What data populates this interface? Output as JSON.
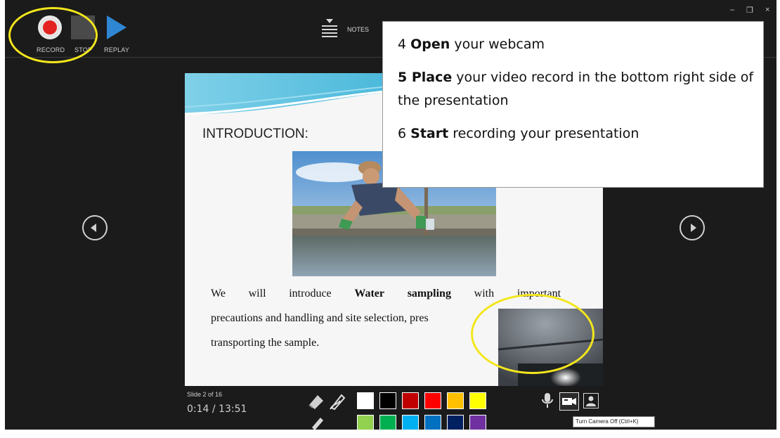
{
  "toolbar": {
    "record_label": "RECORD",
    "stop_label": "STOP",
    "replay_label": "REPLAY",
    "notes_label": "NOTES"
  },
  "window_controls": {
    "minimize": "–",
    "restore": "❐",
    "close": "×"
  },
  "slide": {
    "title": "INTRODUCTION:",
    "body_line1": [
      "We",
      "will",
      "introduce",
      "Water",
      "sampling",
      "with",
      "important"
    ],
    "body_line2": "precautions and handling and site selection, pres",
    "body_line3": "transporting the sample."
  },
  "instructions": {
    "step4_num": "4",
    "step4_bold": "Open",
    "step4_rest": "your webcam",
    "step5_bold": "5 Place",
    "step5_rest": "your video record in the bottom right side of the presentation",
    "step6_num": "6",
    "step6_bold": "Start",
    "step6_rest": "recording your presentation"
  },
  "status": {
    "slide_count": "Slide 2 of 16",
    "timer": "0:14 / 13:51"
  },
  "pen_colors": [
    "#ffffff",
    "#000000",
    "#c00000",
    "#ff0000",
    "#ffc000",
    "#ffff00",
    "#92d050",
    "#00b050",
    "#00b0f0",
    "#0070c0",
    "#002060",
    "#7030a0"
  ],
  "tooltip": {
    "camera": "Turn Camera Off (Ctrl+K)"
  },
  "colors": {
    "background": "#1b1b1b",
    "record_red": "#e32222",
    "replay_blue": "#2f86d2",
    "highlight_yellow": "#f3e61c"
  },
  "icons": {
    "nav_prev": "chevron-left-circle-icon",
    "nav_next": "chevron-right-circle-icon",
    "eraser": "eraser-icon",
    "pen": "pen-icon",
    "highlighter": "highlighter-icon",
    "microphone": "microphone-icon",
    "camera": "camera-icon",
    "camera_preview": "person-icon"
  }
}
